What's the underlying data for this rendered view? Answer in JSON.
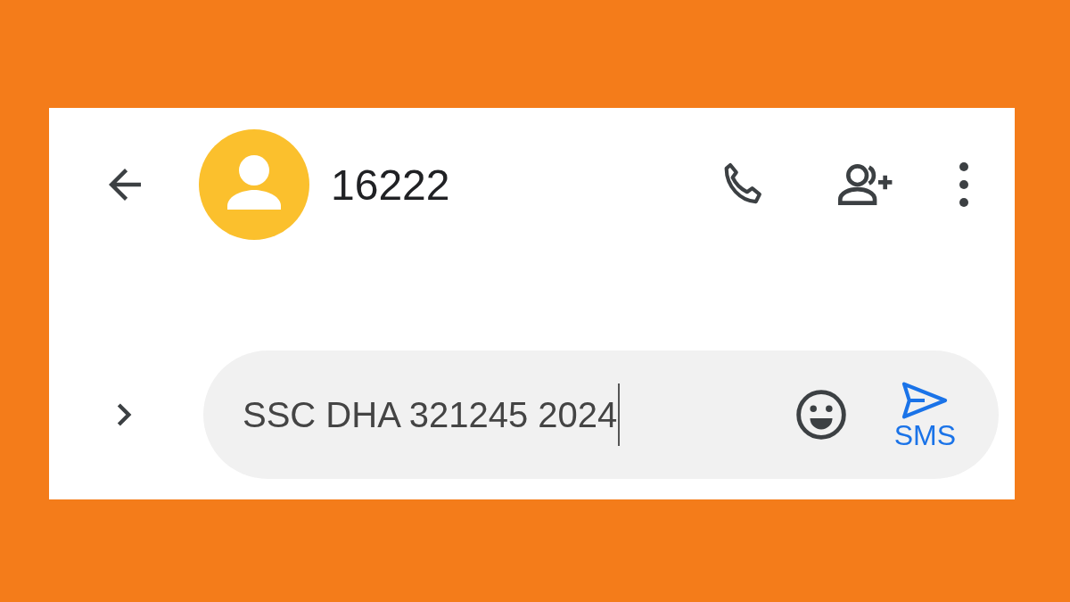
{
  "header": {
    "title": "16222"
  },
  "composer": {
    "value": "SSC DHA 321245 2024",
    "send_label": "SMS"
  }
}
